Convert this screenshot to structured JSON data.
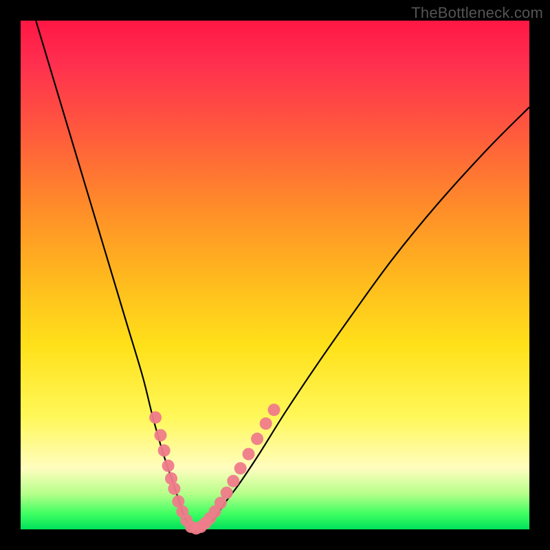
{
  "watermark": "TheBottleneck.com",
  "chart_data": {
    "type": "line",
    "title": "",
    "xlabel": "",
    "ylabel": "",
    "xlim": [
      0,
      100
    ],
    "ylim": [
      0,
      100
    ],
    "series": [
      {
        "name": "bottleneck-curve",
        "x": [
          3,
          6,
          9,
          12,
          15,
          18,
          21,
          24,
          26,
          28,
          30,
          31,
          32,
          33,
          34,
          35,
          36,
          38,
          40,
          43,
          47,
          52,
          58,
          65,
          73,
          82,
          92,
          100
        ],
        "y": [
          100,
          90,
          80,
          70,
          60,
          50,
          40,
          30,
          22,
          15,
          9,
          6,
          3,
          1,
          0,
          0,
          1,
          2,
          5,
          9,
          15,
          23,
          32,
          42,
          53,
          64,
          75,
          83
        ]
      }
    ],
    "markers": {
      "name": "highlight-dots",
      "color": "#ef7b8a",
      "points": [
        {
          "x": 26.5,
          "y": 22
        },
        {
          "x": 27.5,
          "y": 18.5
        },
        {
          "x": 28.2,
          "y": 15.5
        },
        {
          "x": 29.0,
          "y": 12.5
        },
        {
          "x": 29.6,
          "y": 10
        },
        {
          "x": 30.2,
          "y": 8
        },
        {
          "x": 31.0,
          "y": 5.5
        },
        {
          "x": 31.8,
          "y": 3.5
        },
        {
          "x": 32.6,
          "y": 1.8
        },
        {
          "x": 33.5,
          "y": 0.5
        },
        {
          "x": 34.5,
          "y": 0.2
        },
        {
          "x": 35.4,
          "y": 0.5
        },
        {
          "x": 36.3,
          "y": 1.2
        },
        {
          "x": 37.2,
          "y": 2.2
        },
        {
          "x": 38.2,
          "y": 3.5
        },
        {
          "x": 39.3,
          "y": 5.2
        },
        {
          "x": 40.5,
          "y": 7.2
        },
        {
          "x": 41.8,
          "y": 9.5
        },
        {
          "x": 43.2,
          "y": 12
        },
        {
          "x": 44.8,
          "y": 14.8
        },
        {
          "x": 46.5,
          "y": 17.8
        },
        {
          "x": 48.2,
          "y": 20.8
        },
        {
          "x": 49.8,
          "y": 23.5
        }
      ]
    }
  }
}
